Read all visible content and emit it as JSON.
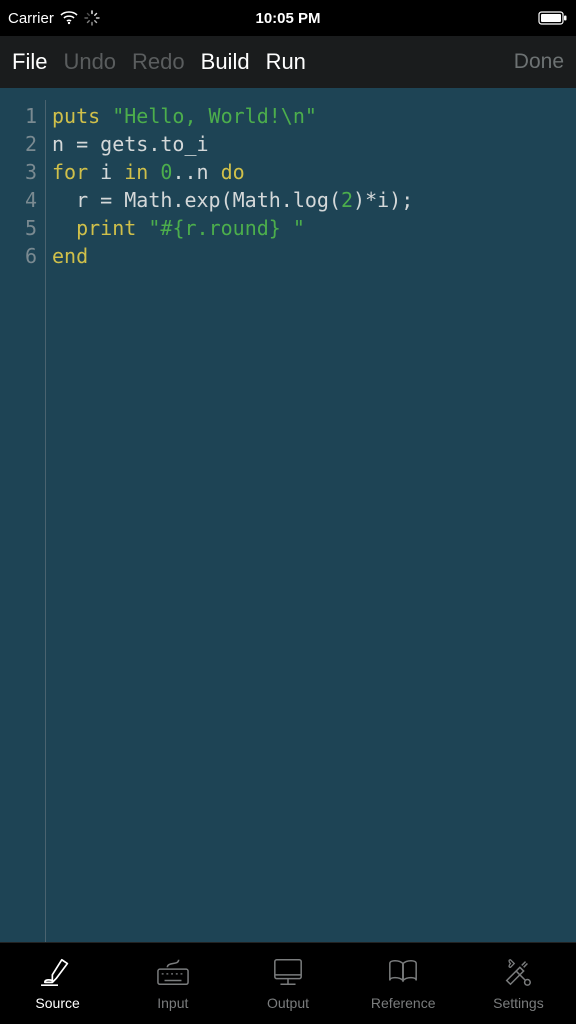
{
  "status": {
    "carrier": "Carrier",
    "time": "10:05 PM"
  },
  "toolbar": {
    "file": "File",
    "undo": "Undo",
    "redo": "Redo",
    "build": "Build",
    "run": "Run",
    "done": "Done"
  },
  "editor": {
    "lines": [
      {
        "n": "1",
        "tokens": [
          {
            "t": "puts",
            "c": "tok-keyword"
          },
          {
            "t": " ",
            "c": ""
          },
          {
            "t": "\"Hello, World!\\n\"",
            "c": "tok-string"
          }
        ]
      },
      {
        "n": "2",
        "tokens": [
          {
            "t": "n = gets.to_i",
            "c": "tok-ident"
          }
        ]
      },
      {
        "n": "3",
        "tokens": [
          {
            "t": "for",
            "c": "tok-keyword"
          },
          {
            "t": " i ",
            "c": "tok-ident"
          },
          {
            "t": "in",
            "c": "tok-keyword"
          },
          {
            "t": " ",
            "c": ""
          },
          {
            "t": "0",
            "c": "tok-number"
          },
          {
            "t": "..n ",
            "c": "tok-ident"
          },
          {
            "t": "do",
            "c": "tok-keyword"
          }
        ]
      },
      {
        "n": "4",
        "tokens": [
          {
            "t": "  r = Math.exp(Math.log(",
            "c": "tok-ident"
          },
          {
            "t": "2",
            "c": "tok-number"
          },
          {
            "t": ")*i);",
            "c": "tok-ident"
          }
        ]
      },
      {
        "n": "5",
        "tokens": [
          {
            "t": "  ",
            "c": ""
          },
          {
            "t": "print",
            "c": "tok-keyword"
          },
          {
            "t": " ",
            "c": ""
          },
          {
            "t": "\"#{r.round} \"",
            "c": "tok-string"
          }
        ]
      },
      {
        "n": "6",
        "tokens": [
          {
            "t": "end",
            "c": "tok-keyword"
          }
        ]
      }
    ]
  },
  "tabs": {
    "source": {
      "label": "Source",
      "active": true
    },
    "input": {
      "label": "Input",
      "active": false
    },
    "output": {
      "label": "Output",
      "active": false
    },
    "reference": {
      "label": "Reference",
      "active": false
    },
    "settings": {
      "label": "Settings",
      "active": false
    }
  }
}
